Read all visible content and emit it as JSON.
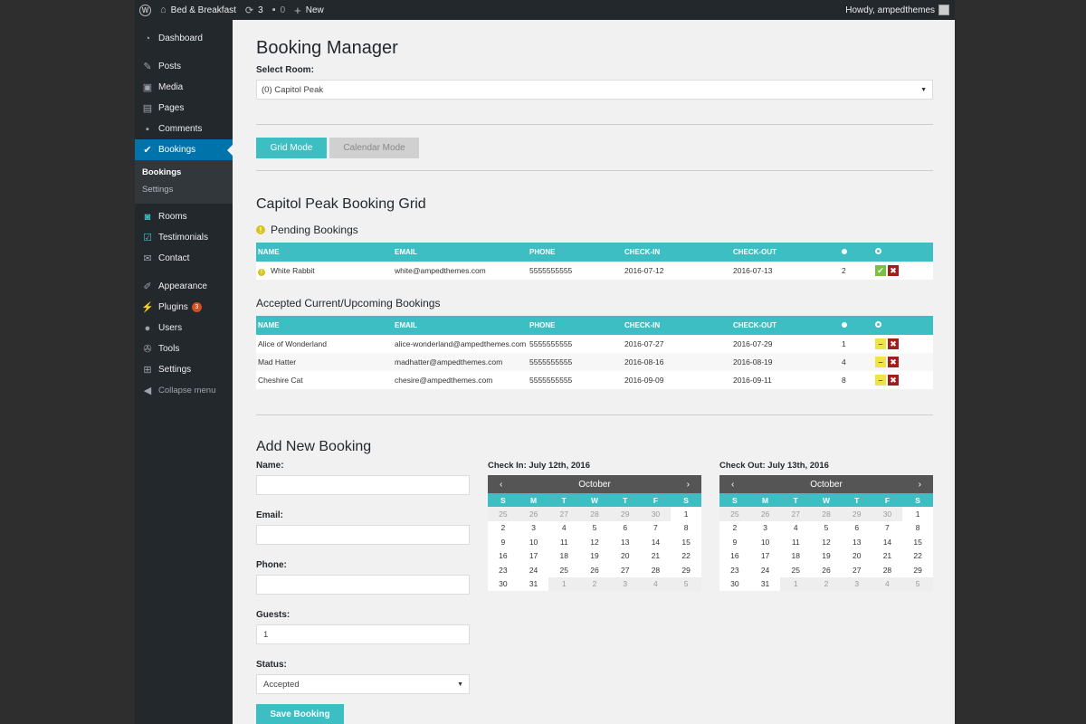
{
  "adminbar": {
    "site_name": "Bed & Breakfast",
    "updates_count": "3",
    "comments_count": "0",
    "new_label": "New",
    "howdy": "Howdy, ampedthemes"
  },
  "sidebar": {
    "items": [
      {
        "label": "Dashboard",
        "icon": "dashboard-icon"
      },
      {
        "label": "Posts",
        "icon": "pin-icon"
      },
      {
        "label": "Media",
        "icon": "media-icon"
      },
      {
        "label": "Pages",
        "icon": "pages-icon"
      },
      {
        "label": "Comments",
        "icon": "comment-icon"
      },
      {
        "label": "Bookings",
        "icon": "check-circle-icon"
      },
      {
        "label": "Rooms",
        "icon": "rooms-icon"
      },
      {
        "label": "Testimonials",
        "icon": "testimonials-icon"
      },
      {
        "label": "Contact",
        "icon": "mail-icon"
      },
      {
        "label": "Appearance",
        "icon": "brush-icon"
      },
      {
        "label": "Plugins",
        "icon": "plugin-icon",
        "badge": "3"
      },
      {
        "label": "Users",
        "icon": "user-icon"
      },
      {
        "label": "Tools",
        "icon": "wrench-icon"
      },
      {
        "label": "Settings",
        "icon": "settings-icon"
      },
      {
        "label": "Collapse menu",
        "icon": "collapse-icon"
      }
    ],
    "submenu": [
      "Bookings",
      "Settings"
    ]
  },
  "page": {
    "title": "Booking Manager",
    "select_room_label": "Select Room:",
    "select_room_value": "(0) Capitol Peak",
    "grid_mode": "Grid Mode",
    "calendar_mode": "Calendar Mode",
    "grid_title": "Capitol Peak Booking Grid",
    "pending_title": "Pending Bookings",
    "accepted_title": "Accepted Current/Upcoming Bookings"
  },
  "table_headers": [
    "NAME",
    "EMAIL",
    "PHONE",
    "CHECK-IN",
    "CHECK-OUT"
  ],
  "pending": [
    {
      "name": "White Rabbit",
      "email": "white@ampedthemes.com",
      "phone": "5555555555",
      "checkin": "2016-07-12",
      "checkout": "2016-07-13",
      "guests": "2"
    }
  ],
  "accepted": [
    {
      "name": "Alice of Wonderland",
      "email": "alice-wonderland@ampedthemes.com",
      "phone": "5555555555",
      "checkin": "2016-07-27",
      "checkout": "2016-07-29",
      "guests": "1"
    },
    {
      "name": "Mad Hatter",
      "email": "madhatter@ampedthemes.com",
      "phone": "5555555555",
      "checkin": "2016-08-16",
      "checkout": "2016-08-19",
      "guests": "4"
    },
    {
      "name": "Cheshire Cat",
      "email": "chesire@ampedthemes.com",
      "phone": "5555555555",
      "checkin": "2016-09-09",
      "checkout": "2016-09-11",
      "guests": "8"
    }
  ],
  "add_booking": {
    "title": "Add New Booking",
    "name_label": "Name:",
    "email_label": "Email:",
    "phone_label": "Phone:",
    "guests_label": "Guests:",
    "guests_value": "1",
    "status_label": "Status:",
    "status_value": "Accepted",
    "save_label": "Save Booking"
  },
  "calendars": {
    "checkin_title": "Check In: July 12th, 2016",
    "checkout_title": "Check Out: July 13th, 2016",
    "month": "October",
    "prev": "‹",
    "next": "›",
    "dow": [
      "S",
      "M",
      "T",
      "W",
      "T",
      "F",
      "S"
    ],
    "days": [
      "25",
      "26",
      "27",
      "28",
      "29",
      "30",
      "1",
      "2",
      "3",
      "4",
      "5",
      "6",
      "7",
      "8",
      "9",
      "10",
      "11",
      "12",
      "13",
      "14",
      "15",
      "16",
      "17",
      "18",
      "19",
      "20",
      "21",
      "22",
      "23",
      "24",
      "25",
      "26",
      "27",
      "28",
      "29",
      "30",
      "31",
      "1",
      "2",
      "3",
      "4",
      "5"
    ],
    "muted_days": [
      0,
      1,
      2,
      3,
      4,
      5,
      37,
      38,
      39,
      40,
      41
    ]
  }
}
